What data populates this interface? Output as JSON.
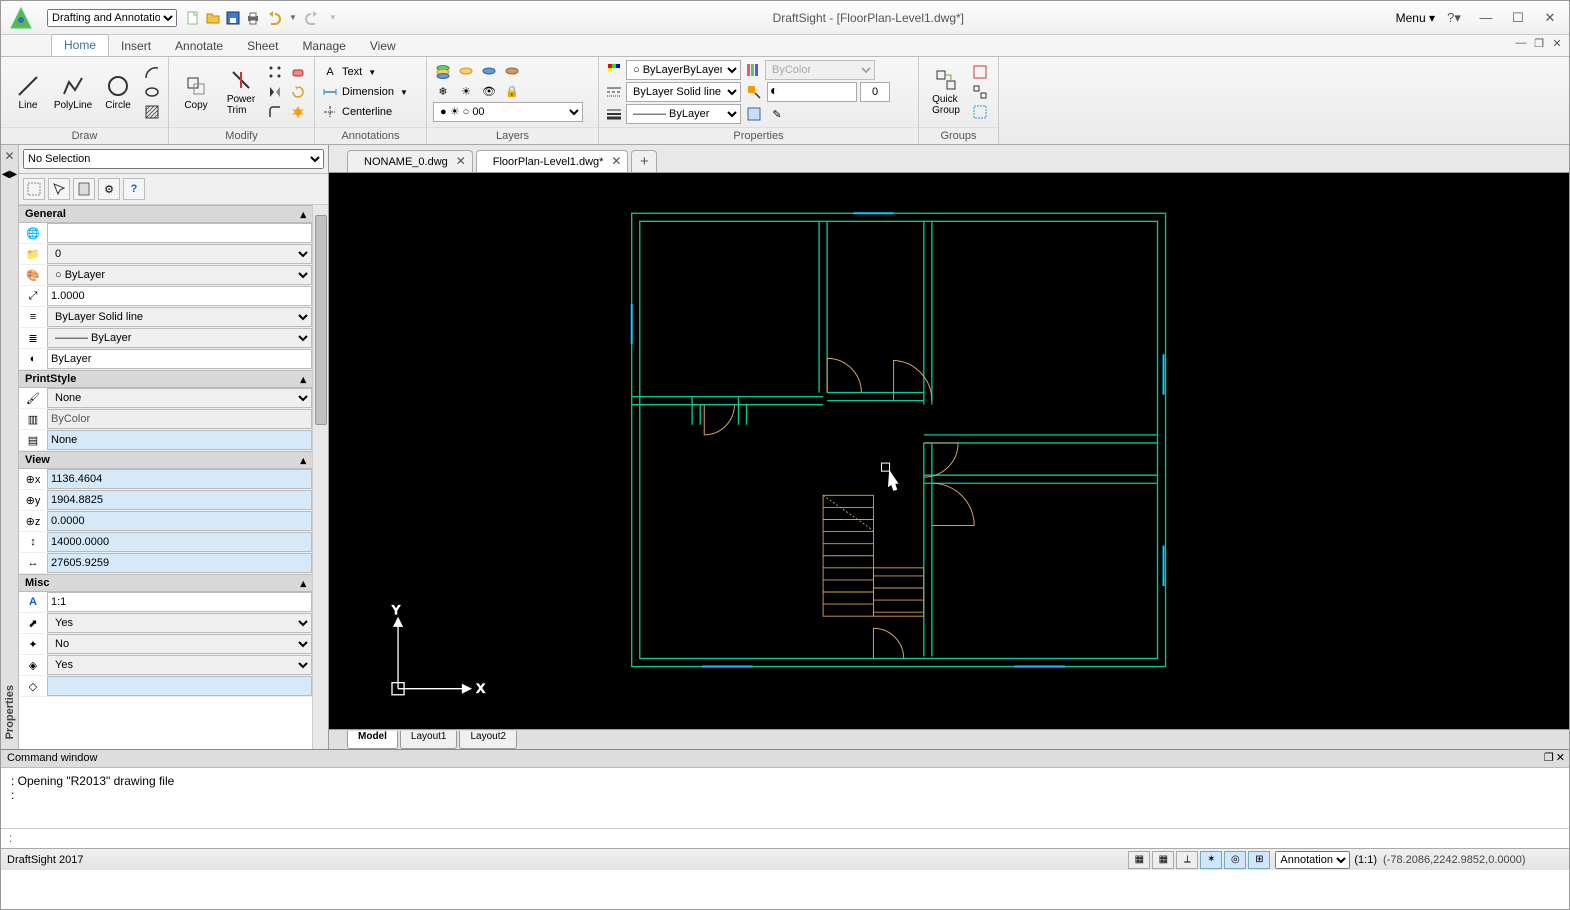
{
  "app_title": "DraftSight - [FloorPlan-Level1.dwg*]",
  "workspace": "Drafting and Annotation",
  "menu_label": "Menu",
  "tabs": [
    "Home",
    "Insert",
    "Annotate",
    "Sheet",
    "Manage",
    "View"
  ],
  "active_tab": "Home",
  "ribbon": {
    "draw": {
      "label": "Draw",
      "line": "Line",
      "polyline": "PolyLine",
      "circle": "Circle"
    },
    "modify": {
      "label": "Modify",
      "copy": "Copy",
      "powertrim": "Power\nTrim"
    },
    "annotations": {
      "label": "Annotations",
      "text": "Text",
      "dimension": "Dimension",
      "centerline": "Centerline"
    },
    "layers": {
      "label": "Layers",
      "current": "0"
    },
    "properties": {
      "label": "Properties",
      "color": "ByLayer",
      "linestyle": "ByLayer    Solid line",
      "lineweight": "ByLayer",
      "printstyle": "ByColor",
      "transparency": "0"
    },
    "groups": {
      "label": "Groups",
      "quick": "Quick\nGroup"
    }
  },
  "doc_tabs": [
    {
      "name": "NONAME_0.dwg",
      "active": false
    },
    {
      "name": "FloorPlan-Level1.dwg*",
      "active": true
    }
  ],
  "layout_tabs": [
    "Model",
    "Layout1",
    "Layout2"
  ],
  "active_layout": "Model",
  "properties_panel": {
    "label": "Properties",
    "selection": "No Selection",
    "general": {
      "label": "General",
      "rows": {
        "hyperlink": "",
        "layer": "0",
        "color": "ByLayer",
        "scale": "1.0000",
        "linestyle": "ByLayer    Solid line",
        "lineweight": "ByLayer",
        "transparency": "ByLayer"
      }
    },
    "printstyle": {
      "label": "PrintStyle",
      "rows": {
        "pstyle": "None",
        "pcolor": "ByColor",
        "ptable": "None"
      }
    },
    "view": {
      "label": "View",
      "rows": {
        "center_x": "1136.4604",
        "center_y": "1904.8825",
        "center_z": "0.0000",
        "height": "14000.0000",
        "width": "27605.9259"
      }
    },
    "misc": {
      "label": "Misc",
      "rows": {
        "annoscale": "1:1",
        "ucsicon": "Yes",
        "ucsorigin": "No",
        "ucs_per": "Yes"
      }
    }
  },
  "command": {
    "label": "Command window",
    "history": "Opening \"R2013\" drawing file",
    "prompt": ""
  },
  "status": {
    "product": "DraftSight 2017",
    "annotation": "Annotation",
    "scale_ratio": "(1:1)",
    "coords": "(-78.2086,2242.9852,0.0000)"
  }
}
